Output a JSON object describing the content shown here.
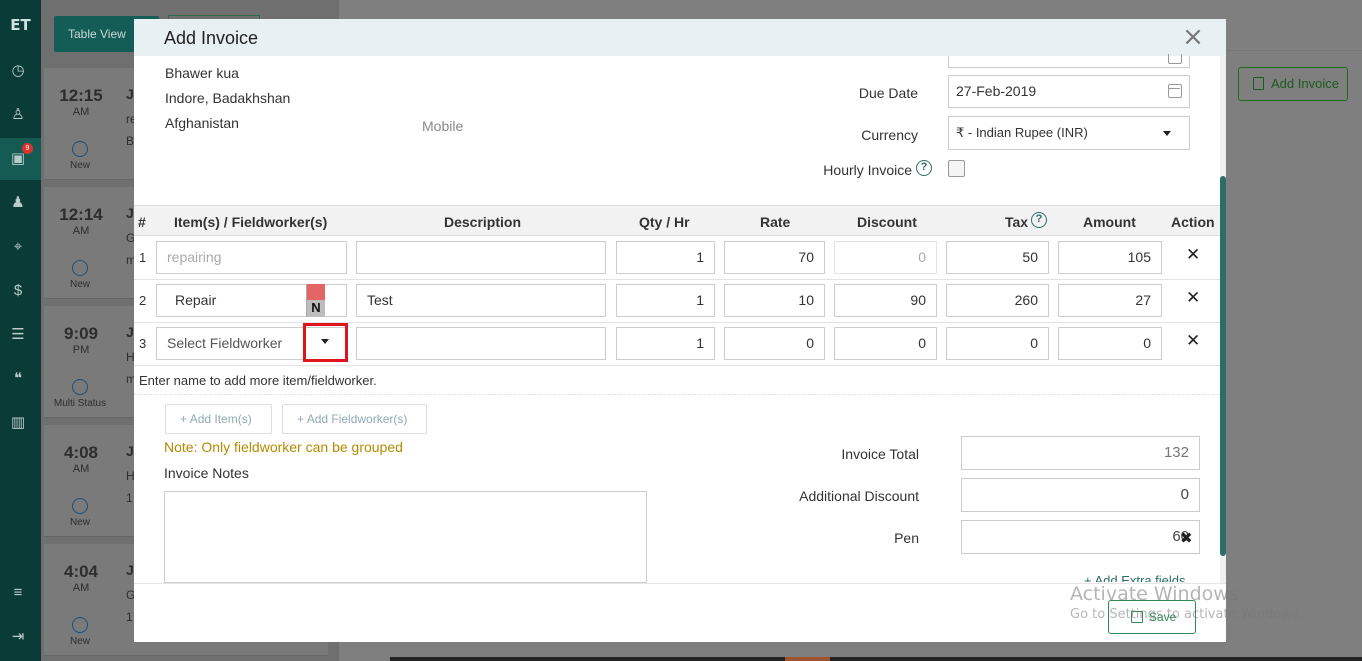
{
  "app": {
    "logo": "ET",
    "badge_count": "9"
  },
  "background": {
    "view_button": "Table View",
    "add_invoice_button": "Add Invoice",
    "appointments": [
      {
        "time": "12:15",
        "ampm": "AM",
        "status": "New",
        "name": "Ji",
        "line2": "re",
        "line3": "B"
      },
      {
        "time": "12:14",
        "ampm": "AM",
        "status": "New",
        "name": "Ji",
        "line2": "G",
        "line3": "m"
      },
      {
        "time": "9:09",
        "ampm": "PM",
        "status": "Multi Status",
        "name": "Ji",
        "line2": "H",
        "line3": "m"
      },
      {
        "time": "4:08",
        "ampm": "AM",
        "status": "New",
        "name": "Ji",
        "line2": "H",
        "line3": "1"
      },
      {
        "time": "4:04",
        "ampm": "AM",
        "status": "New",
        "name": "Ji",
        "line2": "G",
        "line3": "1"
      }
    ]
  },
  "modal": {
    "title": "Add Invoice",
    "close_icon": "×",
    "address": [
      "Bhawer kua",
      "Indore, Badakhshan",
      "Afghanistan"
    ],
    "mobile_label": "Mobile",
    "due_date": {
      "label": "Due Date",
      "value": "27-Feb-2019"
    },
    "currency": {
      "label": "Currency",
      "value": "₹ - Indian Rupee (INR)"
    },
    "hourly": {
      "label": "Hourly Invoice",
      "help": "?"
    },
    "table": {
      "headers": {
        "num": "#",
        "item": "Item(s) / Fieldworker(s)",
        "desc": "Description",
        "qty": "Qty / Hr",
        "rate": "Rate",
        "discount": "Discount",
        "tax": "Tax",
        "amount": "Amount",
        "action": "Action"
      },
      "rows": [
        {
          "num": "1",
          "item": "repairing",
          "desc": "",
          "qty": "1",
          "rate": "70",
          "discount": "0",
          "tax": "50",
          "amount": "105"
        },
        {
          "num": "2",
          "item": "Repair",
          "flag": "N",
          "desc": "Test",
          "qty": "1",
          "rate": "10",
          "discount": "90",
          "tax": "260",
          "amount": "27"
        },
        {
          "num": "3",
          "item": "Select Fieldworker",
          "desc": "",
          "qty": "1",
          "rate": "0",
          "discount": "0",
          "tax": "0",
          "amount": "0"
        }
      ],
      "remove_icon": "✕",
      "hint": "Enter name to add more item/fieldworker."
    },
    "add_item_button": "Add Item(s)",
    "add_fieldworker_button": "Add Fieldworker(s)",
    "note": "Note: Only fieldworker can be grouped",
    "notes_label": "Invoice Notes",
    "totals": {
      "invoice_total": {
        "label": "Invoice Total",
        "value": "132"
      },
      "additional_discount": {
        "label": "Additional Discount",
        "value": "0"
      },
      "pen": {
        "label": "Pen",
        "value": "60"
      }
    },
    "add_extra_fields": "+ Add Extra fields",
    "save_button": "Save"
  },
  "watermark": {
    "line1": "Activate Windows",
    "line2": "Go to Settings to activate Windows."
  }
}
